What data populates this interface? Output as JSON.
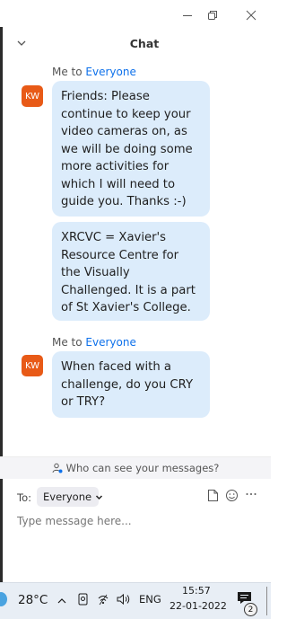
{
  "window": {
    "minimize_icon": "minimize-icon",
    "restore_icon": "restore-icon",
    "close_icon": "close-icon"
  },
  "chat": {
    "title": "Chat",
    "collapse_icon": "chevron-down-icon"
  },
  "messages": [
    {
      "sender_prefix": "Me to ",
      "recipient": "Everyone",
      "avatar_initials": "KW",
      "avatar_color": "#e85a17",
      "bubbles": [
        "Friends: Please continue to keep your video cameras on, as we will be doing some more activities for which I will need to guide you. Thanks :-)",
        "XRCVC = Xavier's Resource Centre for the Visually Challenged. It is a part of St Xavier's College."
      ]
    },
    {
      "sender_prefix": "Me to ",
      "recipient": "Everyone",
      "avatar_initials": "KW",
      "avatar_color": "#e85a17",
      "bubbles": [
        "When faced with a challenge, do you CRY or TRY?"
      ]
    }
  ],
  "who_can_see": {
    "text": "Who can see your messages?",
    "icon": "person-icon"
  },
  "composer": {
    "to_label": "To:",
    "recipient": "Everyone",
    "placeholder": "Type message here...",
    "file_icon": "file-icon",
    "emoji_icon": "emoji-icon",
    "more_icon": "more-icon"
  },
  "taskbar": {
    "temperature": "28°C",
    "language": "ENG",
    "time": "15:57",
    "date": "22-01-2022",
    "notification_count": "2"
  },
  "colors": {
    "bubble": "#dcecfb",
    "accent": "#0e71eb",
    "avatar": "#e85a17"
  }
}
